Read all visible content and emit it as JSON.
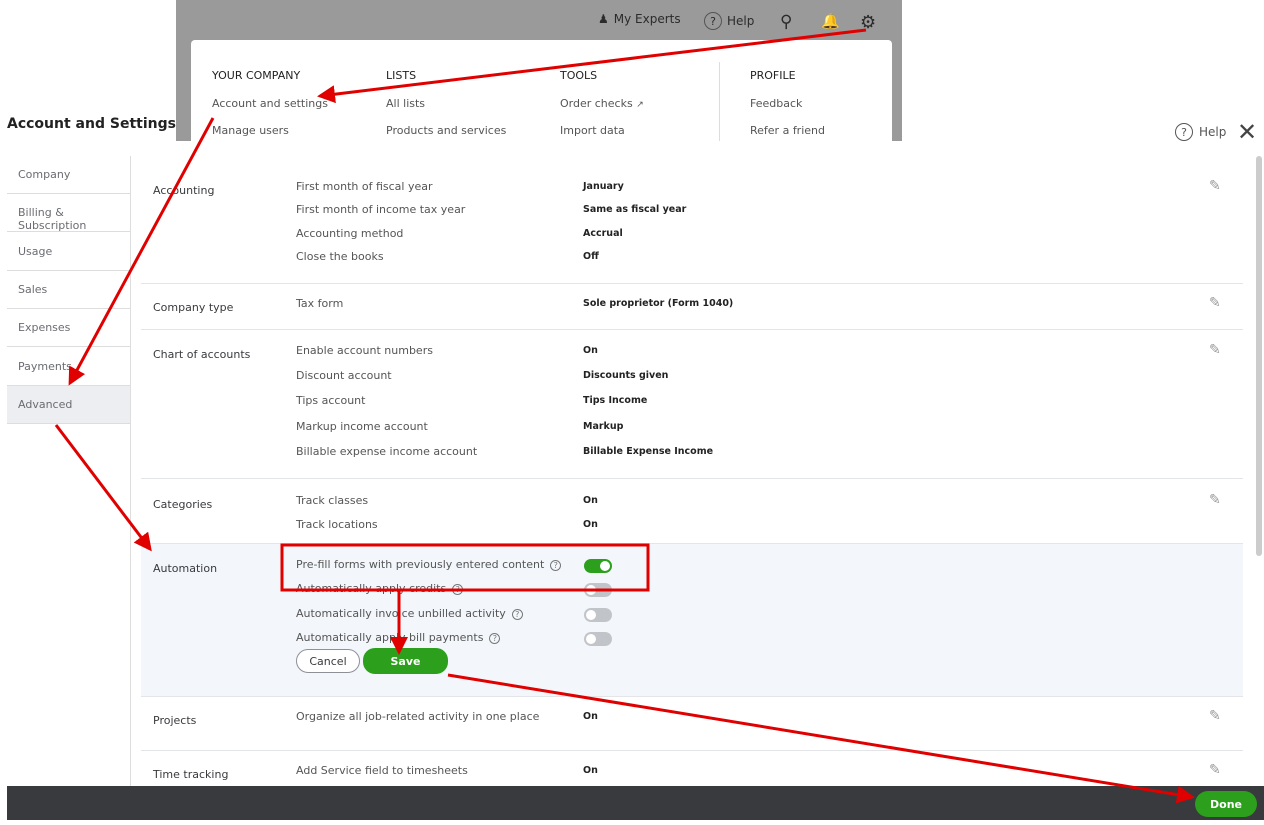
{
  "topbar": {
    "my_experts": "My Experts",
    "help": "Help"
  },
  "menu": {
    "your_company": {
      "heading": "YOUR COMPANY",
      "items": [
        "Account and settings",
        "Manage users"
      ]
    },
    "lists": {
      "heading": "LISTS",
      "items": [
        "All lists",
        "Products and services"
      ]
    },
    "tools": {
      "heading": "TOOLS",
      "items": [
        "Order checks",
        "Import data"
      ]
    },
    "profile": {
      "heading": "PROFILE",
      "items": [
        "Feedback",
        "Refer a friend"
      ]
    }
  },
  "page": {
    "title": "Account and Settings",
    "help": "Help"
  },
  "sidebar": {
    "items": [
      "Company",
      "Billing & Subscription",
      "Usage",
      "Sales",
      "Expenses",
      "Payments",
      "Advanced"
    ],
    "active": "Advanced"
  },
  "sections": {
    "accounting": {
      "label": "Accounting",
      "items": [
        [
          "First month of fiscal year",
          "January"
        ],
        [
          "First month of income tax year",
          "Same as fiscal year"
        ],
        [
          "Accounting method",
          "Accrual"
        ],
        [
          "Close the books",
          "Off"
        ]
      ]
    },
    "company_type": {
      "label": "Company type",
      "items": [
        [
          "Tax form",
          "Sole proprietor (Form 1040)"
        ]
      ]
    },
    "chart_of_accounts": {
      "label": "Chart of accounts",
      "items": [
        [
          "Enable account numbers",
          "On"
        ],
        [
          "Discount account",
          "Discounts given"
        ],
        [
          "Tips account",
          "Tips Income"
        ],
        [
          "Markup income account",
          "Markup"
        ],
        [
          "Billable expense income account",
          "Billable Expense Income"
        ]
      ]
    },
    "categories": {
      "label": "Categories",
      "items": [
        [
          "Track classes",
          "On"
        ],
        [
          "Track locations",
          "On"
        ]
      ]
    },
    "automation": {
      "label": "Automation",
      "items": [
        {
          "label": "Pre-fill forms with previously entered content",
          "on": true
        },
        {
          "label": "Automatically apply credits",
          "on": false
        },
        {
          "label": "Automatically invoice unbilled activity",
          "on": false
        },
        {
          "label": "Automatically apply bill payments",
          "on": false
        }
      ],
      "cancel": "Cancel",
      "save": "Save"
    },
    "projects": {
      "label": "Projects",
      "items": [
        [
          "Organize all job-related activity in one place",
          "On"
        ]
      ]
    },
    "time_tracking": {
      "label": "Time tracking",
      "items": [
        [
          "Add Service field to timesheets",
          "On"
        ]
      ]
    }
  },
  "footer": {
    "done": "Done"
  },
  "colors": {
    "accent": "#2ca01c",
    "annotation": "#e00000"
  }
}
